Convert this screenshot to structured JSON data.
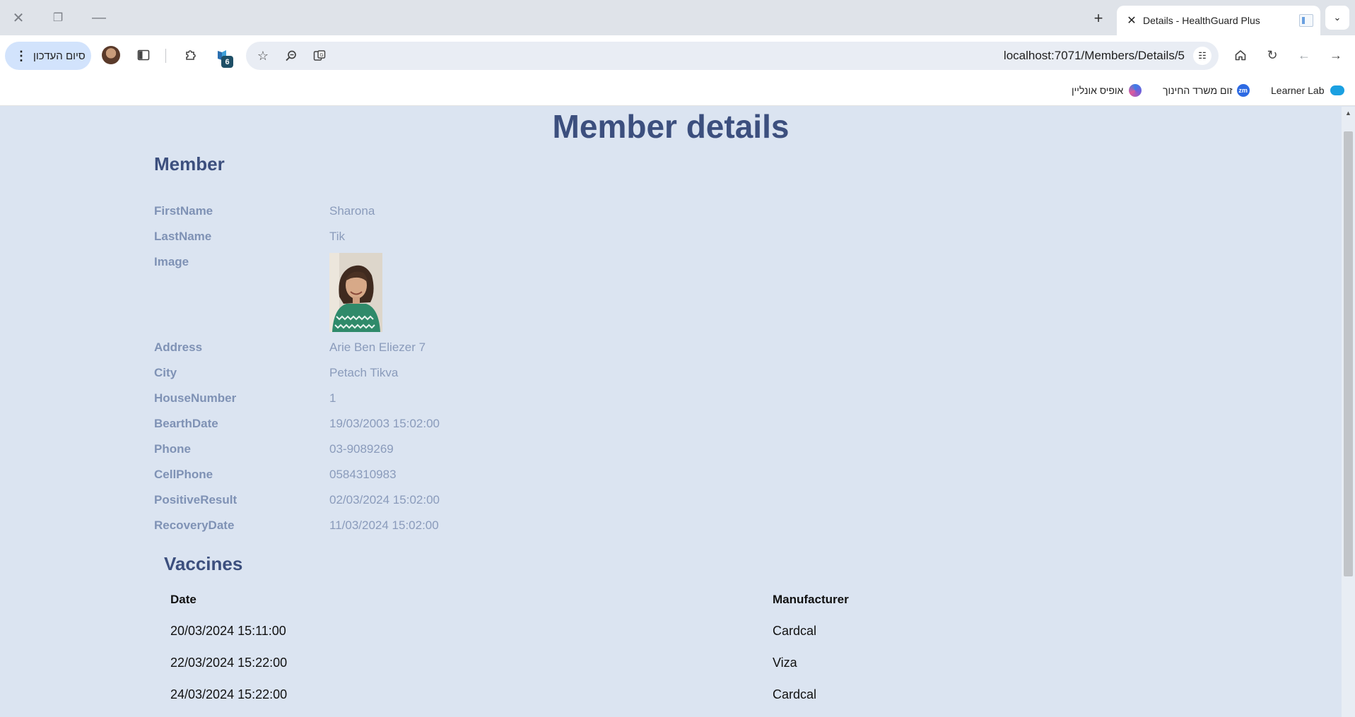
{
  "browser": {
    "tab_title": "Details - HealthGuard Plus",
    "url": "localhost:7071/Members/Details/5",
    "update_button_label": "סיום העדכון",
    "extensions_badge": "6",
    "bookmarks": [
      {
        "label": "Learner Lab",
        "icon": "cloud-icon",
        "color": "#1ba0e1"
      },
      {
        "label": "זום משרד החינוך",
        "icon": "zoom-icon",
        "icon_text": "zm",
        "color": "#2d6ae3"
      },
      {
        "label": "אופיס אונליין",
        "icon": "office-icon",
        "color": "#7b5cd6"
      }
    ]
  },
  "page": {
    "title": "Member details",
    "section_title": "Member",
    "fields": [
      {
        "label": "FirstName",
        "value": "Sharona"
      },
      {
        "label": "LastName",
        "value": "Tik"
      },
      {
        "label": "Image",
        "value": ""
      },
      {
        "label": "Address",
        "value": "Arie Ben Eliezer 7"
      },
      {
        "label": "City",
        "value": "Petach Tikva"
      },
      {
        "label": "HouseNumber",
        "value": "1"
      },
      {
        "label": "BearthDate",
        "value": "19/03/2003 15:02:00"
      },
      {
        "label": "Phone",
        "value": "03-9089269"
      },
      {
        "label": "CellPhone",
        "value": "0584310983"
      },
      {
        "label": "PositiveResult",
        "value": "02/03/2024 15:02:00"
      },
      {
        "label": "RecoveryDate",
        "value": "11/03/2024 15:02:00"
      }
    ],
    "vaccines": {
      "title": "Vaccines",
      "headers": [
        "Date",
        "Manufacturer"
      ],
      "rows": [
        [
          "20/03/2024 15:11:00",
          "Cardcal"
        ],
        [
          "22/03/2024 15:22:00",
          "Viza"
        ],
        [
          "24/03/2024 15:22:00",
          "Cardcal"
        ]
      ]
    }
  },
  "colors": {
    "page_background": "#dbe4f1",
    "heading": "#3c4f7e",
    "label": "#7f92b5",
    "value": "#8a9bbb"
  }
}
